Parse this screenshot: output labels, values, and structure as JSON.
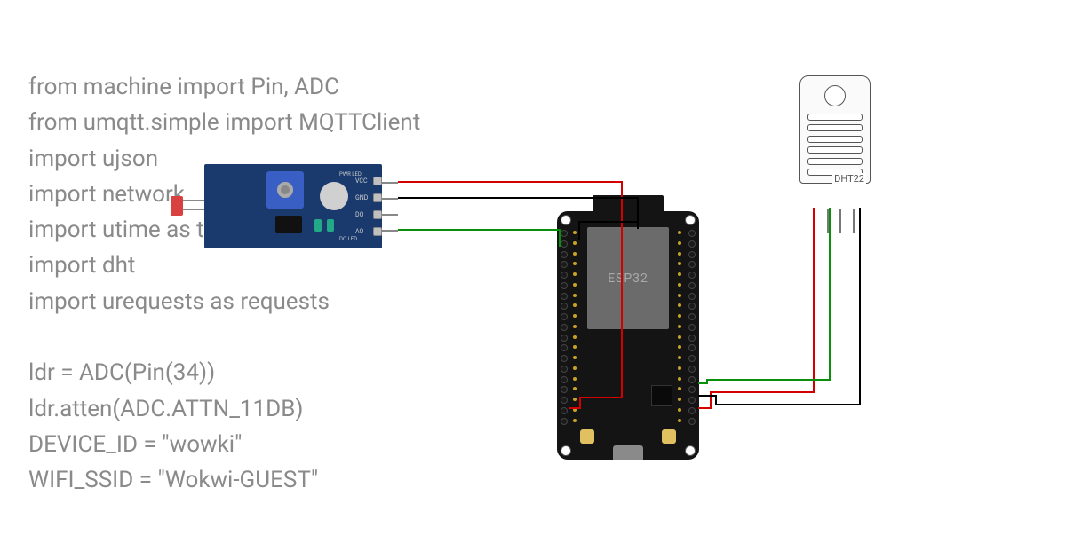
{
  "code": {
    "lines": [
      "from machine import Pin, ADC",
      "from umqtt.simple import MQTTClient",
      "import ujson",
      "import network",
      "import utime as time",
      "import dht",
      "import urequests as requests",
      "",
      "ldr = ADC(Pin(34))",
      "ldr.atten(ADC.ATTN_11DB)",
      "DEVICE_ID = \"wowki\"",
      "WIFI_SSID = \"Wokwi-GUEST\""
    ]
  },
  "components": {
    "esp32": {
      "label": "ESP32"
    },
    "dht22": {
      "label": "DHT22"
    },
    "ldr": {
      "pins": [
        "VCC",
        "GND",
        "DO",
        "AO"
      ],
      "labels": {
        "pwr": "PWR\nLED",
        "do": "DO\nLED"
      }
    }
  },
  "wires": [
    {
      "name": "ldr-vcc-to-3v3",
      "color": "#d40000"
    },
    {
      "name": "ldr-gnd-to-gnd",
      "color": "#000000"
    },
    {
      "name": "ldr-ao-to-vp34",
      "color": "#0a8f0a"
    },
    {
      "name": "dht-vcc-to-3v3",
      "color": "#d40000"
    },
    {
      "name": "dht-gnd-to-gnd",
      "color": "#000000"
    },
    {
      "name": "dht-data-to-d15",
      "color": "#0a8f0a"
    }
  ]
}
